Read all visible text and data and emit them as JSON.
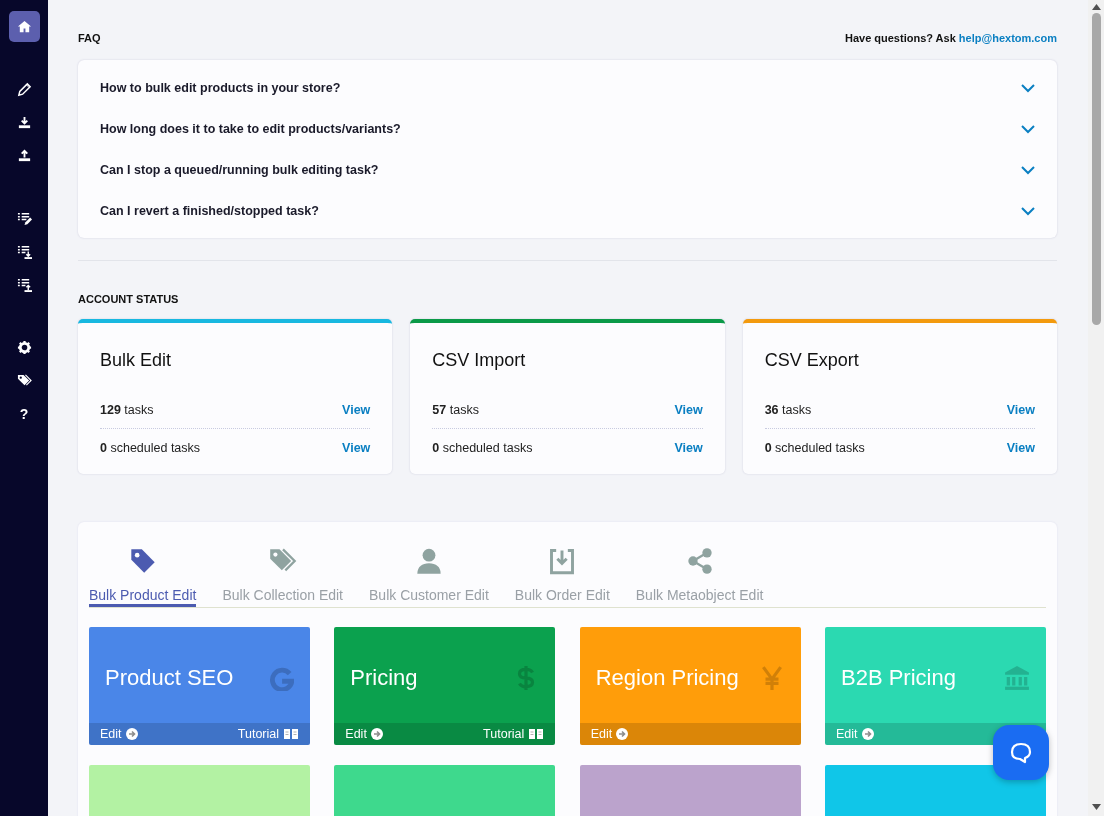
{
  "sidebar": {
    "items": [
      {
        "selected": true
      },
      {
        "selected": false
      },
      {
        "selected": false
      },
      {
        "selected": false
      },
      {
        "selected": false
      },
      {
        "selected": false
      },
      {
        "selected": false
      },
      {
        "selected": false
      },
      {
        "selected": false
      },
      {
        "selected": false
      }
    ],
    "help": "?"
  },
  "faq": {
    "title": "FAQ",
    "contact": "Have questions? Ask ",
    "email": "help@hextom.com",
    "items": [
      {
        "question": "How to bulk edit products in your store?",
        "expanded": false
      },
      {
        "question": "How long does it to take to edit products/variants?",
        "expanded": false
      },
      {
        "question": "Can I stop a queued/running bulk editing task?",
        "expanded": false
      },
      {
        "question": "Can I revert a finished/stopped task?",
        "expanded": false
      }
    ]
  },
  "account_status": {
    "title": "ACCOUNT STATUS",
    "cards": [
      {
        "title": "Bulk Edit",
        "color": "#18b8e0",
        "rows": [
          {
            "text": "**129** tasks",
            "link": "View"
          },
          {
            "text": "**0** scheduled tasks",
            "link": "View"
          }
        ]
      },
      {
        "title": "CSV Import",
        "color": "#0b9a48",
        "rows": [
          {
            "text": "**57** tasks",
            "link": "View"
          },
          {
            "text": "**0** scheduled tasks",
            "link": "View"
          }
        ]
      },
      {
        "title": "CSV Export",
        "color": "#f39a0e",
        "rows": [
          {
            "text": "**36** tasks",
            "link": "View"
          },
          {
            "text": "**0** scheduled tasks",
            "link": "View"
          }
        ]
      }
    ]
  },
  "tools": {
    "tabs": [
      {
        "label": "Bulk Product Edit",
        "selected": true
      },
      {
        "label": "Bulk Collection Edit",
        "selected": false
      },
      {
        "label": "Bulk Customer Edit",
        "selected": false
      },
      {
        "label": "Bulk Order Edit",
        "selected": false
      },
      {
        "label": "Bulk Metaobject Edit",
        "selected": false
      }
    ],
    "tiles": [
      {
        "title": "Product SEO",
        "color": "#4a86e8",
        "edit": "Edit",
        "tutorial": "Tutorial"
      },
      {
        "title": "Pricing",
        "color": "#0ba14e",
        "edit": "Edit",
        "tutorial": "Tutorial"
      },
      {
        "title": "Region Pricing",
        "color": "#ff9d0a",
        "edit": "Edit"
      },
      {
        "title": "B2B Pricing",
        "color": "#2bd9b1",
        "edit": "Edit"
      },
      {
        "color": "#b3f2a3"
      },
      {
        "color": "#3ed98d"
      },
      {
        "color": "#bba3cc"
      },
      {
        "color": "#10c6e8"
      }
    ]
  }
}
